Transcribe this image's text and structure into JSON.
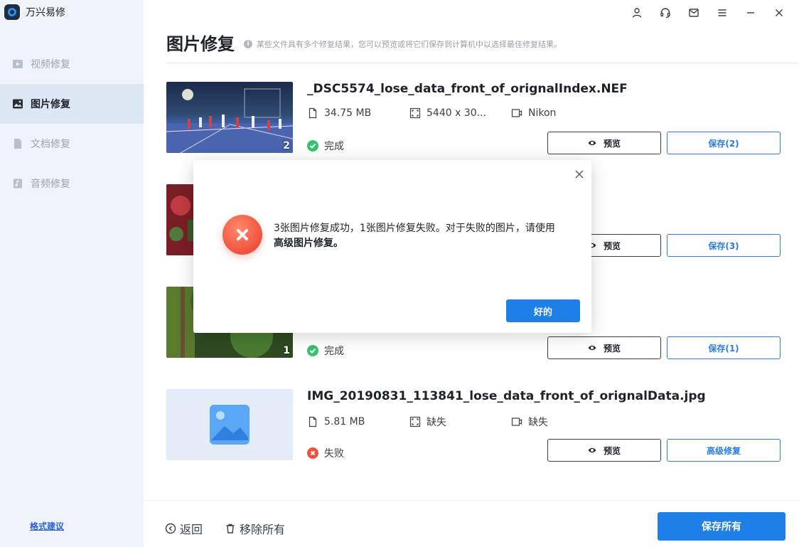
{
  "app": {
    "name": "万兴易修"
  },
  "sidebar": {
    "items": [
      {
        "label": "视频修复",
        "icon": "video-icon",
        "active": false
      },
      {
        "label": "图片修复",
        "icon": "image-icon",
        "active": true
      },
      {
        "label": "文档修复",
        "icon": "document-icon",
        "active": false
      },
      {
        "label": "音频修复",
        "icon": "audio-icon",
        "active": false
      }
    ],
    "feedback": "格式建议"
  },
  "page": {
    "title": "图片修复",
    "hint": "某些文件具有多个修复结果，您可以预览或将它们保存到计算机中以选择最佳修复结果。"
  },
  "files": [
    {
      "name": "_DSC5574_lose_data_front_of_orignalIndex.NEF",
      "size": "34.75  MB",
      "dimensions": "5440 x 30...",
      "camera": "Nikon",
      "status": "完成",
      "preview_label": "预览",
      "action_label": "保存(2)",
      "count": "2"
    },
    {
      "name": "",
      "size": "",
      "dimensions": "",
      "camera": "",
      "status": "",
      "preview_label": "预览",
      "action_label": "保存(3)",
      "count": ""
    },
    {
      "name": "",
      "size": "",
      "dimensions": "",
      "camera": "",
      "status": "完成",
      "preview_label": "预览",
      "action_label": "保存(1)",
      "count": "1"
    },
    {
      "name": "IMG_20190831_113841_lose_data_front_of_orignalData.jpg",
      "size": "5.81  MB",
      "dimensions": "缺失",
      "camera": "缺失",
      "status": "失败",
      "preview_label": "预览",
      "action_label": "高级修复",
      "count": ""
    }
  ],
  "bottom": {
    "back": "返回",
    "remove_all": "移除所有",
    "save_all": "保存所有"
  },
  "modal": {
    "message": "3张图片修复成功，1张图片修复失败。对于失败的图片，请使用",
    "emphasis": "高级图片修复。",
    "ok": "好的"
  },
  "colors": {
    "accent": "#1e7fe8",
    "success": "#32c36c",
    "error": "#f0503c",
    "sidebar_bg": "#f0f4fa"
  }
}
